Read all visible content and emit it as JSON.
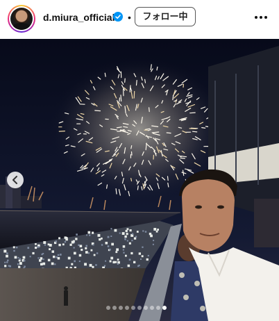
{
  "post": {
    "username": "d.miura_official",
    "verified": true,
    "separator": "•",
    "follow_label": "フォロー中",
    "more_icon": "more-horizontal-icon",
    "verified_icon": "verified-badge-icon"
  },
  "carousel": {
    "total_slides": 10,
    "active_index": 9,
    "prev_icon": "chevron-left-icon"
  },
  "colors": {
    "verified": "#0095f6",
    "follow_border": "#555555",
    "night_sky": "#0b0f22"
  }
}
